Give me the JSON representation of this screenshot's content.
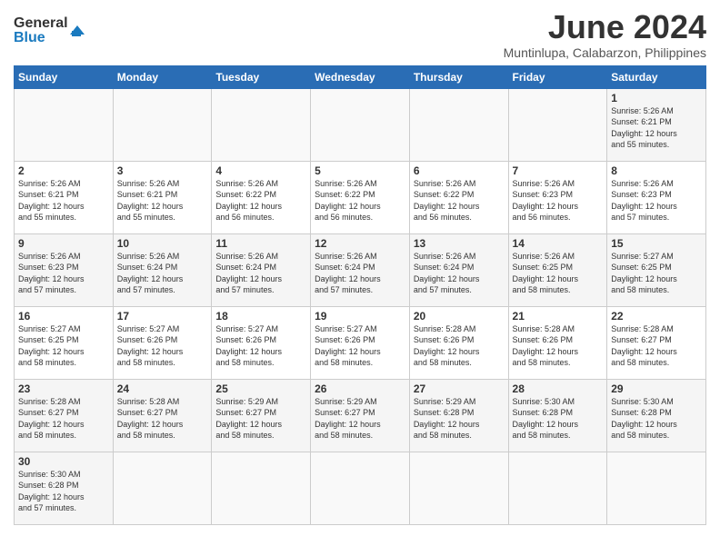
{
  "header": {
    "logo_general": "General",
    "logo_blue": "Blue",
    "month_title": "June 2024",
    "subtitle": "Muntinlupa, Calabarzon, Philippines"
  },
  "weekdays": [
    "Sunday",
    "Monday",
    "Tuesday",
    "Wednesday",
    "Thursday",
    "Friday",
    "Saturday"
  ],
  "weeks": [
    [
      {
        "day": null,
        "info": ""
      },
      {
        "day": null,
        "info": ""
      },
      {
        "day": null,
        "info": ""
      },
      {
        "day": null,
        "info": ""
      },
      {
        "day": null,
        "info": ""
      },
      {
        "day": null,
        "info": ""
      },
      {
        "day": "1",
        "info": "Sunrise: 5:26 AM\nSunset: 6:21 PM\nDaylight: 12 hours\nand 55 minutes."
      }
    ],
    [
      {
        "day": "2",
        "info": "Sunrise: 5:26 AM\nSunset: 6:21 PM\nDaylight: 12 hours\nand 55 minutes."
      },
      {
        "day": "3",
        "info": "Sunrise: 5:26 AM\nSunset: 6:21 PM\nDaylight: 12 hours\nand 55 minutes."
      },
      {
        "day": "4",
        "info": "Sunrise: 5:26 AM\nSunset: 6:22 PM\nDaylight: 12 hours\nand 56 minutes."
      },
      {
        "day": "5",
        "info": "Sunrise: 5:26 AM\nSunset: 6:22 PM\nDaylight: 12 hours\nand 56 minutes."
      },
      {
        "day": "6",
        "info": "Sunrise: 5:26 AM\nSunset: 6:22 PM\nDaylight: 12 hours\nand 56 minutes."
      },
      {
        "day": "7",
        "info": "Sunrise: 5:26 AM\nSunset: 6:23 PM\nDaylight: 12 hours\nand 56 minutes."
      },
      {
        "day": "8",
        "info": "Sunrise: 5:26 AM\nSunset: 6:23 PM\nDaylight: 12 hours\nand 57 minutes."
      }
    ],
    [
      {
        "day": "9",
        "info": "Sunrise: 5:26 AM\nSunset: 6:23 PM\nDaylight: 12 hours\nand 57 minutes."
      },
      {
        "day": "10",
        "info": "Sunrise: 5:26 AM\nSunset: 6:24 PM\nDaylight: 12 hours\nand 57 minutes."
      },
      {
        "day": "11",
        "info": "Sunrise: 5:26 AM\nSunset: 6:24 PM\nDaylight: 12 hours\nand 57 minutes."
      },
      {
        "day": "12",
        "info": "Sunrise: 5:26 AM\nSunset: 6:24 PM\nDaylight: 12 hours\nand 57 minutes."
      },
      {
        "day": "13",
        "info": "Sunrise: 5:26 AM\nSunset: 6:24 PM\nDaylight: 12 hours\nand 57 minutes."
      },
      {
        "day": "14",
        "info": "Sunrise: 5:26 AM\nSunset: 6:25 PM\nDaylight: 12 hours\nand 58 minutes."
      },
      {
        "day": "15",
        "info": "Sunrise: 5:27 AM\nSunset: 6:25 PM\nDaylight: 12 hours\nand 58 minutes."
      }
    ],
    [
      {
        "day": "16",
        "info": "Sunrise: 5:27 AM\nSunset: 6:25 PM\nDaylight: 12 hours\nand 58 minutes."
      },
      {
        "day": "17",
        "info": "Sunrise: 5:27 AM\nSunset: 6:26 PM\nDaylight: 12 hours\nand 58 minutes."
      },
      {
        "day": "18",
        "info": "Sunrise: 5:27 AM\nSunset: 6:26 PM\nDaylight: 12 hours\nand 58 minutes."
      },
      {
        "day": "19",
        "info": "Sunrise: 5:27 AM\nSunset: 6:26 PM\nDaylight: 12 hours\nand 58 minutes."
      },
      {
        "day": "20",
        "info": "Sunrise: 5:28 AM\nSunset: 6:26 PM\nDaylight: 12 hours\nand 58 minutes."
      },
      {
        "day": "21",
        "info": "Sunrise: 5:28 AM\nSunset: 6:26 PM\nDaylight: 12 hours\nand 58 minutes."
      },
      {
        "day": "22",
        "info": "Sunrise: 5:28 AM\nSunset: 6:27 PM\nDaylight: 12 hours\nand 58 minutes."
      }
    ],
    [
      {
        "day": "23",
        "info": "Sunrise: 5:28 AM\nSunset: 6:27 PM\nDaylight: 12 hours\nand 58 minutes."
      },
      {
        "day": "24",
        "info": "Sunrise: 5:28 AM\nSunset: 6:27 PM\nDaylight: 12 hours\nand 58 minutes."
      },
      {
        "day": "25",
        "info": "Sunrise: 5:29 AM\nSunset: 6:27 PM\nDaylight: 12 hours\nand 58 minutes."
      },
      {
        "day": "26",
        "info": "Sunrise: 5:29 AM\nSunset: 6:27 PM\nDaylight: 12 hours\nand 58 minutes."
      },
      {
        "day": "27",
        "info": "Sunrise: 5:29 AM\nSunset: 6:28 PM\nDaylight: 12 hours\nand 58 minutes."
      },
      {
        "day": "28",
        "info": "Sunrise: 5:30 AM\nSunset: 6:28 PM\nDaylight: 12 hours\nand 58 minutes."
      },
      {
        "day": "29",
        "info": "Sunrise: 5:30 AM\nSunset: 6:28 PM\nDaylight: 12 hours\nand 58 minutes."
      }
    ],
    [
      {
        "day": "30",
        "info": "Sunrise: 5:30 AM\nSunset: 6:28 PM\nDaylight: 12 hours\nand 57 minutes."
      },
      {
        "day": null,
        "info": ""
      },
      {
        "day": null,
        "info": ""
      },
      {
        "day": null,
        "info": ""
      },
      {
        "day": null,
        "info": ""
      },
      {
        "day": null,
        "info": ""
      },
      {
        "day": null,
        "info": ""
      }
    ]
  ]
}
